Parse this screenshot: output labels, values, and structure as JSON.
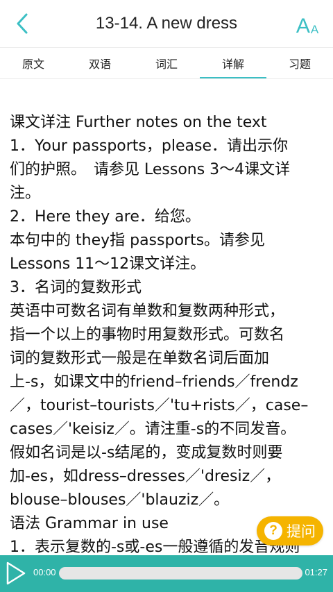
{
  "header": {
    "title": "13-14.  A new dress",
    "back_icon": "chevron-left-icon",
    "font_icon": {
      "big": "A",
      "small": "A"
    }
  },
  "tabs": [
    {
      "label": "原文",
      "active": false
    },
    {
      "label": "双语",
      "active": false
    },
    {
      "label": "词汇",
      "active": false
    },
    {
      "label": "详解",
      "active": true
    },
    {
      "label": "习题",
      "active": false
    }
  ],
  "content": {
    "lines": [
      "课文详注 Further notes on the text",
      "1．Your passports，please．请出示你",
      "们的护照。　请参见 Lessons 3～4课文详",
      "注。",
      "2．Here they are．给您。",
      "本句中的 they指 passports。请参见",
      "Lessons 11～12课文详注。",
      "3．名词的复数形式",
      "英语中可数名词有单数和复数两种形式，",
      "指一个以上的事物时用复数形式。可数名",
      "词的复数形式一般是在单数名词后面加",
      "上-s，如课文中的friend–friends／frendz",
      "／，tourist–tourists／'tu+rists／，case–",
      "cases／'keisiz／。请注重-s的不同发音。",
      "假如名词是以-s结尾的，变成复数时则要",
      "加-es，如dress–dresses／'dresiz／，",
      "blouse–blouses／'blauziz／。",
      " 语法 Grammar in use",
      "1．表示复数的-s或-es一般遵循的发音规则"
    ]
  },
  "ask_button": {
    "label": "提问",
    "icon_glyph": "?"
  },
  "player": {
    "current_time": "00:00",
    "total_time": "01:27",
    "progress": 0
  },
  "colors": {
    "accent": "#3bbfc4",
    "player_bg": "#2fb3a8",
    "ask_bg": "#f5b400"
  }
}
